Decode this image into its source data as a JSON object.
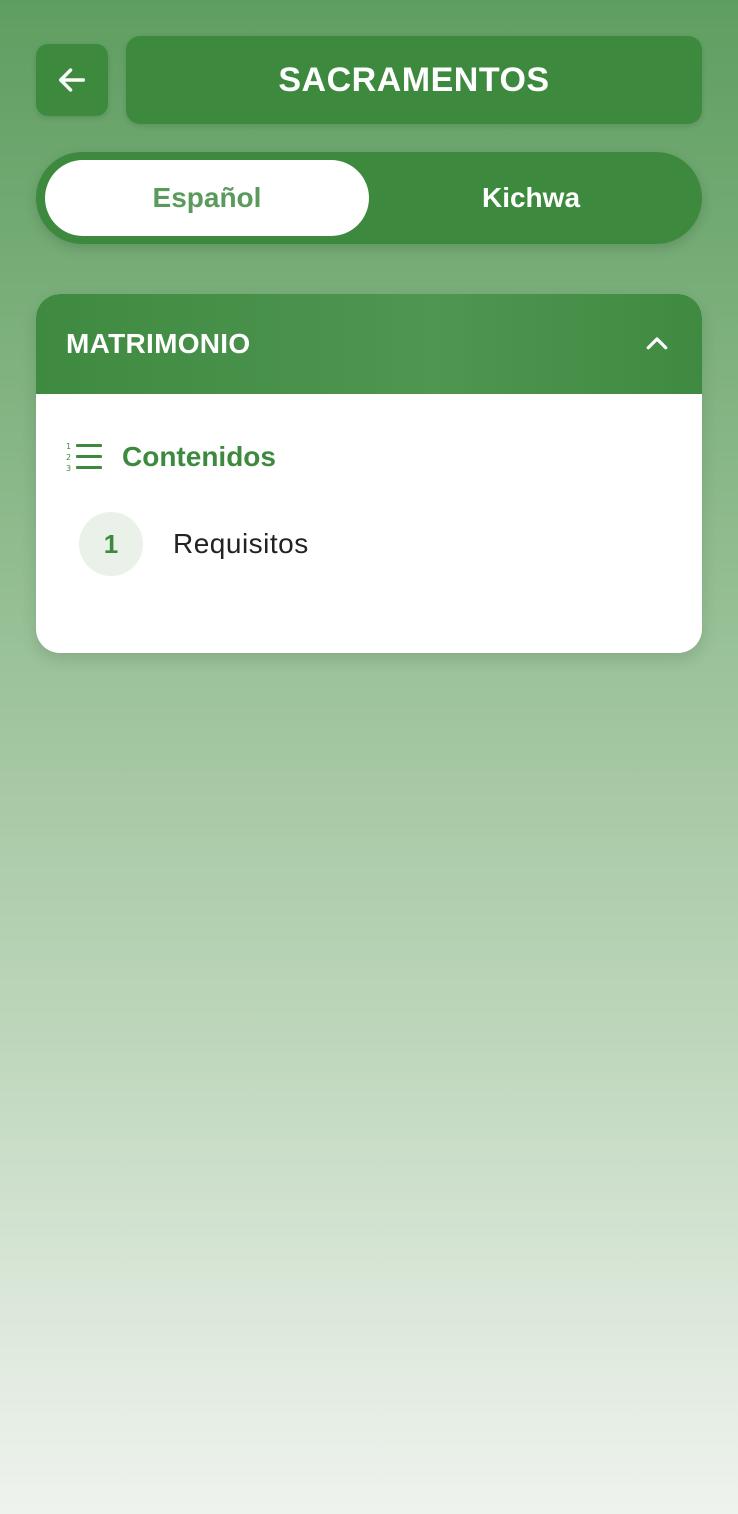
{
  "header": {
    "back_icon": "arrow-left-icon",
    "title": "SACRAMENTOS"
  },
  "language_toggle": {
    "options": [
      {
        "label": "Español",
        "selected": true
      },
      {
        "label": "Kichwa",
        "selected": false
      }
    ]
  },
  "section": {
    "title": "MATRIMONIO",
    "expanded": true,
    "collapse_icon": "chevron-up-icon",
    "contents_label": "Contenidos",
    "contents_icon": "numbered-list-icon",
    "items": [
      {
        "number": "1",
        "label": "Requisitos"
      }
    ]
  },
  "colors": {
    "primary_green": "#3d8a3f",
    "active_text_green": "#5a9a5c",
    "background_top": "#5f9e61",
    "background_bottom": "#eef3ee"
  }
}
